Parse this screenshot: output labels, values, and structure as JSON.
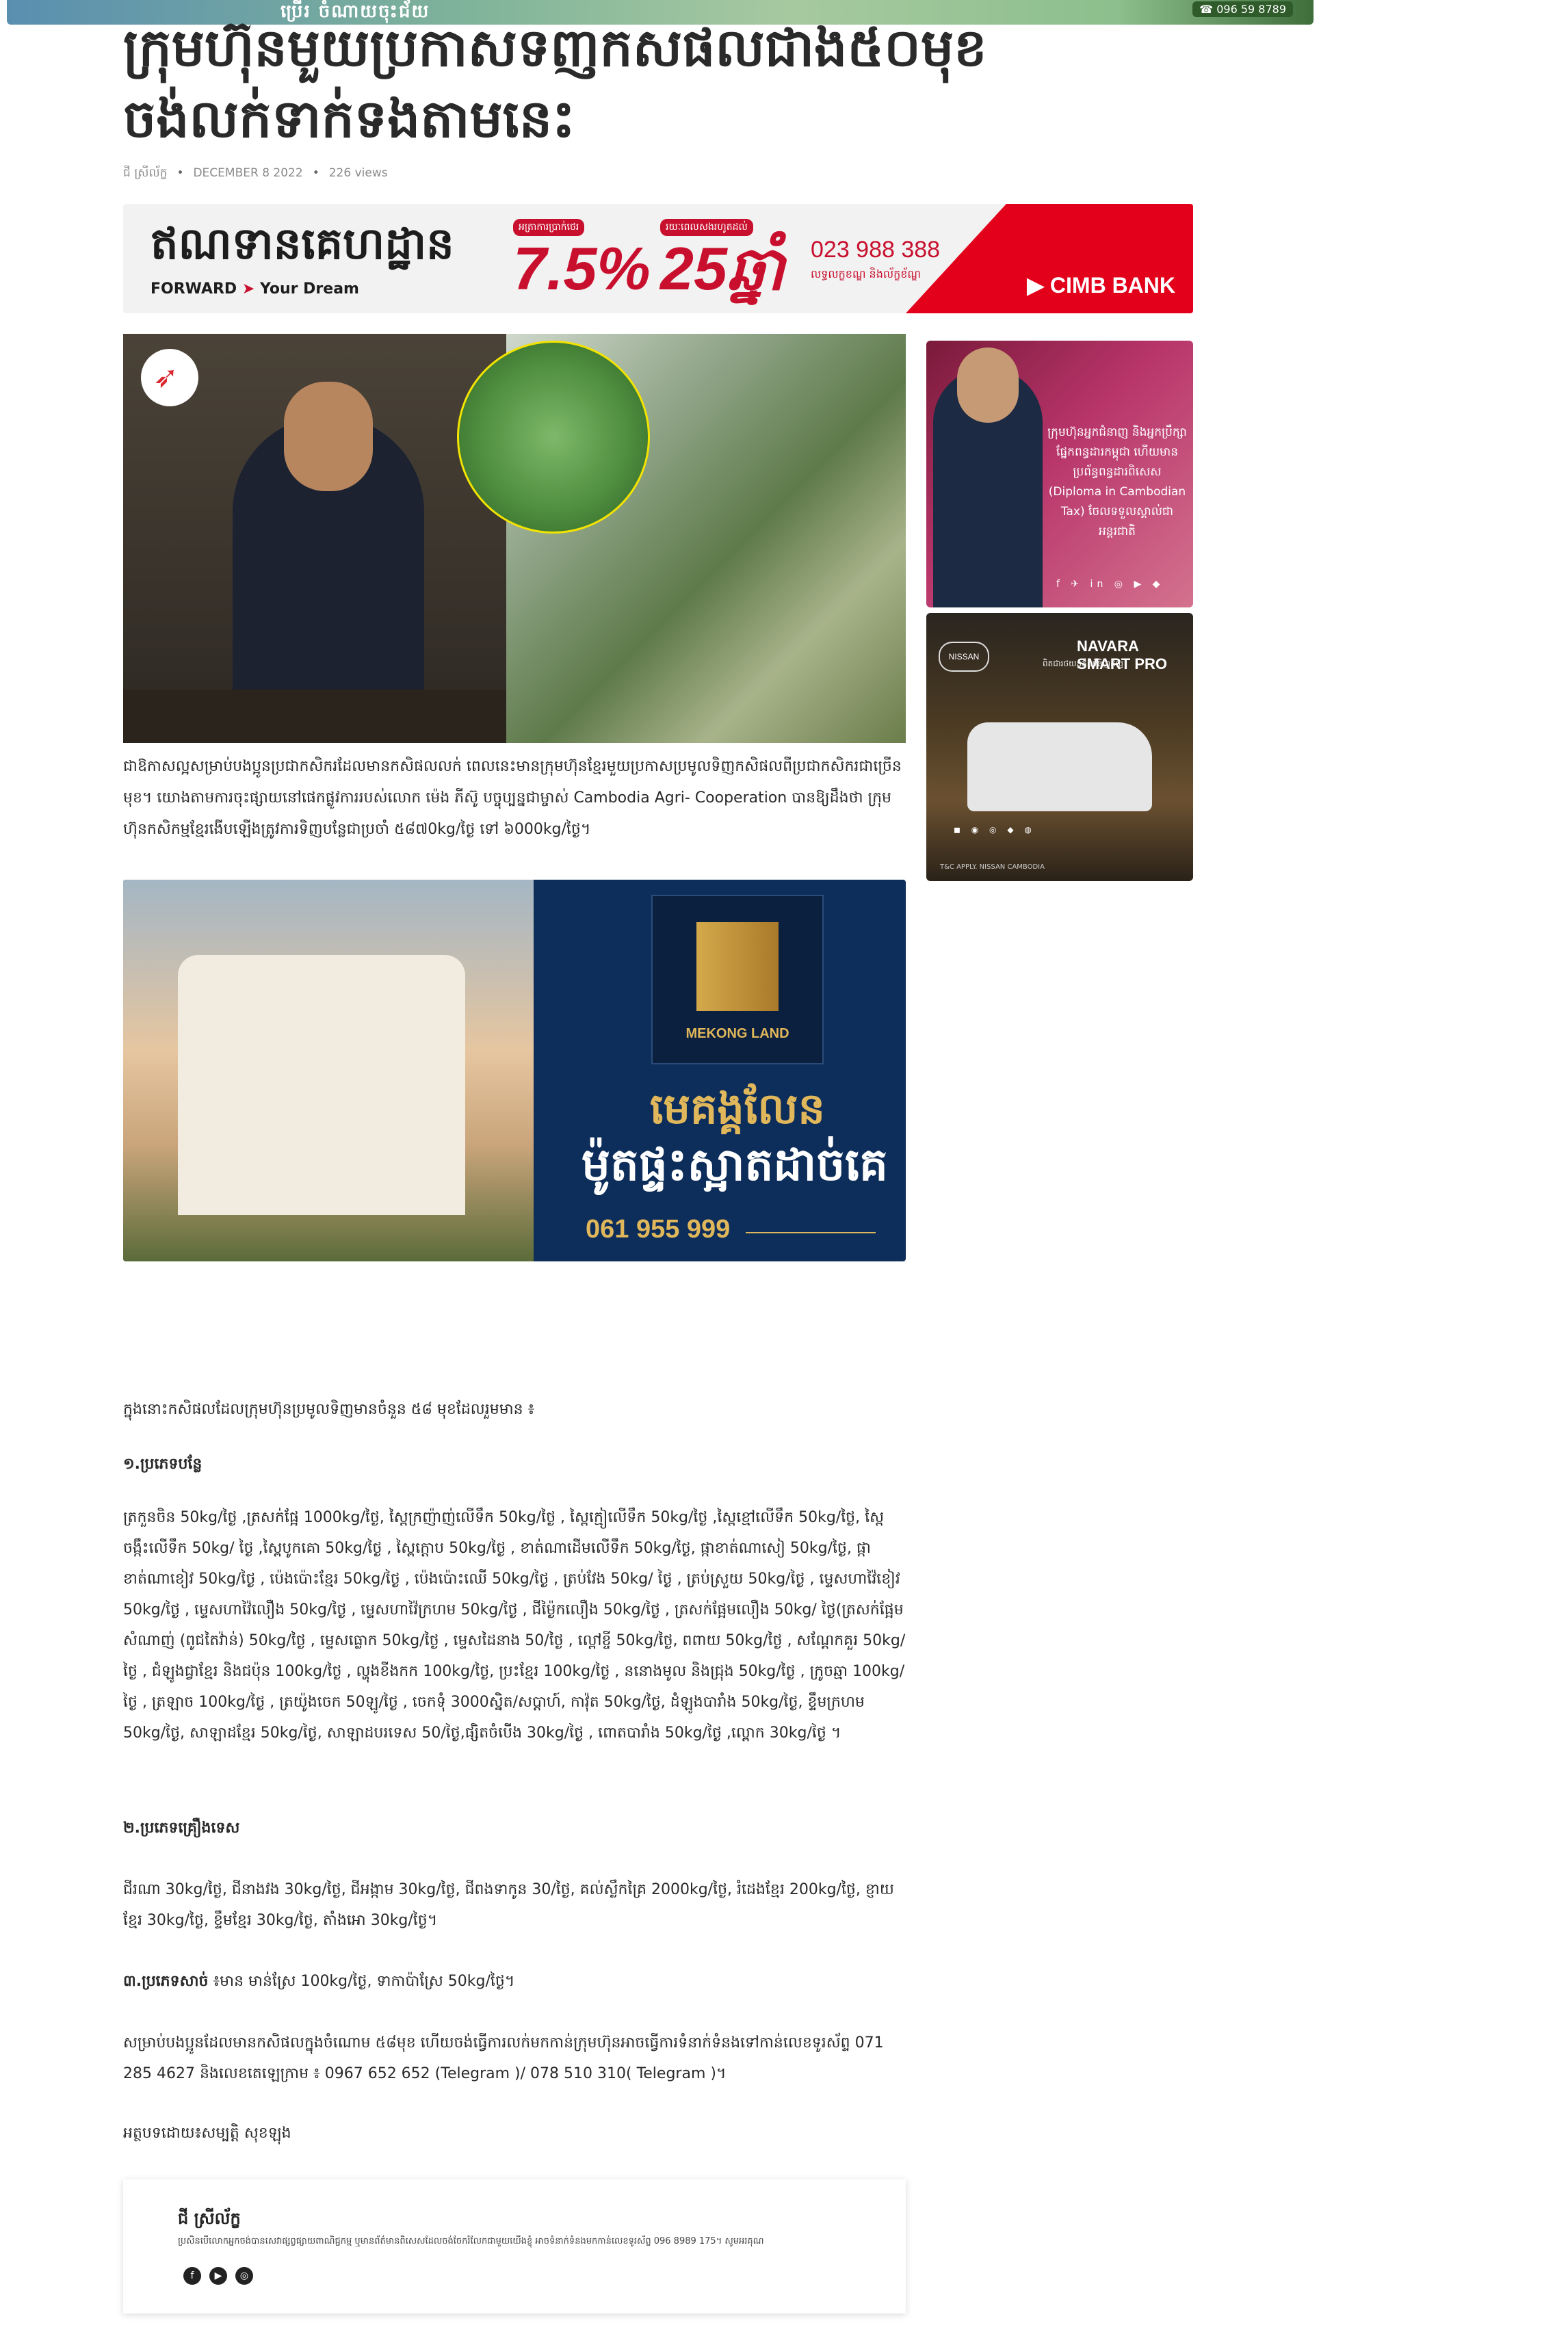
{
  "top_ad": {
    "text": "ប្រើរ ចំណាយចុះជ័យ",
    "phone": "☎ 096 59 8789"
  },
  "article": {
    "title": "ក្រុមហ៊ុនមួយប្រកាសទញកសផលជាង៥០មុខ ចង់លក់ទាក់ទងតាមនេះ",
    "author": "ជី ស្រីល័ក្ខ",
    "date": "DECEMBER 8 2022",
    "views": "226 views"
  },
  "cimb_banner": {
    "slogan": "ឥណទានគេហដ្ឋាន",
    "forward": "FORWARD",
    "your_dream": "Your Dream",
    "tag1": "អត្រាការប្រាក់ថេរ",
    "rate": "7.5%",
    "tag2": "រយៈពេលសងរហូតដល់",
    "years": "25ឆ្នាំ",
    "phone": "023 988 388",
    "phone_sub": "លទ្ធលក្ខខណ្ឌ និងល័ក្ខខ័ណ្ឌ",
    "brand": "CIMB BANK"
  },
  "hero_caption": "ជាឱកាសល្អសម្រាប់បងប្អូនប្រជាកសិករដែលមានកសិផលលក់ ពេលនេះមានក្រុមហ៊ុនខ្មែរមួយប្រកាសប្រមូលទិញកសិផលពីប្រជាកសិករជាច្រើនមុខ។ យោងតាមការចុះផ្សាយនៅផេកផ្លូវការរបស់លោក ម៉េង ភីស៊ូ បច្ចុប្បន្នជាម្ចាស់ Cambodia Agri- Cooperation បានឱ្យដឹងថា ក្រុមហ៊ុនកសិកម្មខ្មែរងើបឡើងត្រូវការទិញបន្លែជាប្រចាំ ៥៨៧0kg/ថ្ងៃ ទៅ ៦000kg/ថ្ងៃ។",
  "mekong_ad": {
    "logo_name": "MEKONG LAND",
    "line1": "មេគង្គលែន",
    "line2": "ម៉ូតផ្ទះស្អាតដាច់គេ",
    "phone": "061 955 999"
  },
  "side_ads": {
    "tax": {
      "text": "ក្រុមហ៊ុនអ្នកជំនាញ និងអ្នកប្រឹក្សាផ្នែកពន្ធដារកម្ពុជា ហើយមានប្រព័ន្ធពន្ធដារពិសេស (Diploma in Cambodian Tax) ចែលទទួលស្គាល់ជាអន្តរជាតិ",
      "icons": "f ✈ in ◎ ▶ ◆"
    },
    "nissan": {
      "brand": "NISSAN",
      "model": "NAVARA SMART PRO",
      "sub": "ពិតជារថយន្តដឹកទំនិញដ៏ល្អ",
      "features": "◼ ◉ ◎ ◆ ◍",
      "foot": "T&C APPLY. NISSAN CAMBODIA"
    }
  },
  "body": {
    "intro": "ក្នុងនោះកសិផលដែលក្រុមហ៊ុនប្រមូលទិញមានចំនួន ៥៨ មុខដែលរួមមាន ៖",
    "h1": "១.ប្រភេទបន្លែ",
    "p1": "ត្រកួនចិន 50kg/ថ្ងៃ ,ត្រសក់ផ្អែ 1000kg/ថ្ងៃ, ស្ពៃក្រញ៉ាញ់លើទឹក 50kg/ថ្ងៃ , ស្ពៃក្មៀលើទឹក 50kg/ថ្ងៃ ,ស្ពៃខ្មៅលើទឹក 50kg/ថ្ងៃ, ស្ពៃចង្កឹះលើទឹក 50kg/ ថ្ងៃ ,ស្ពៃបូកគោ 50kg/ថ្ងៃ , ស្ពៃក្ដោប 50kg/ថ្ងៃ , ខាត់ណាដើមលើទឹក 50kg/ថ្ងៃ, ផ្កាខាត់ណាសៀ 50kg/ថ្ងៃ, ផ្កាខាត់ណាខៀវ 50kg/ថ្ងៃ , ប៉េងប៉ោះខ្មែរ 50kg/ថ្ងៃ , ប៉េងប៉ោះឈើ 50kg/ថ្ងៃ , ត្រប់វែង 50kg/ ថ្ងៃ , ត្រប់ស្រួយ 50kg/ថ្ងៃ , ម្ទេសហាវ៉ៃខៀវ 50kg/ថ្ងៃ , ម្ទេសហាវ៉ៃលឿង 50kg/ថ្ងៃ , ម្ទេសហាវ៉ៃក្រហម 50kg/ថ្ងៃ , ជីម៉្ងៃកលឿង 50kg/ថ្ងៃ , ត្រសក់ផ្អែមលឿង 50kg/ ថ្ងៃ(ត្រសក់ផ្អែមសំណាញ់ (ពូជតៃវ៉ាន់) 50kg/ថ្ងៃ , ម្ទេសធ្លោក 50kg/ថ្ងៃ , ម្ទេសដៃនាង 50/ថ្ងៃ , ល្ពៅខ្ចី 50kg/ថ្ងៃ, ពពាយ 50kg/ថ្ងៃ , សណ្ដែកគួរ 50kg/ថ្ងៃ , ជំឡូងជ្វាខ្មែរ និងជប៉ុន 100kg/ថ្ងៃ , ល្ហុងខីងកក 100kg/ថ្ងៃ, ប្រះខ្មែរ 100kg/ថ្ងៃ , ននោងមូល និងជ្រុង 50kg/ថ្ងៃ , ក្រូចឆ្មា 100kg/ថ្ងៃ , ត្រឡាច 100kg/ថ្ងៃ , ត្រយ៉ូងចេក 50ឡូ/ថ្ងៃ , ចេកទុំ 3000ស្និត/សប្ដាហ៍, កាវ៉ុត 50kg/ថ្ងៃ, ដំឡូងបារាំង 50kg/ថ្ងៃ, ខ្ទឹមក្រហម 50kg/ថ្ងៃ, សាឡាដខ្មែរ 50kg/ថ្ងៃ, សាឡាដបរទេស 50/ថ្ងៃ,ផ្សិតចំបើង 30kg/ថ្ងៃ , ពោតបារាំង 50kg/ថ្ងៃ ,ល្ពោក 30kg/ថ្ងៃ ។",
    "h2": "២.ប្រភេទគ្រឿងទេស",
    "p2": "ជីរណា 30kg/ថ្ងៃ, ជីនាងវង 30kg/ថ្ងៃ, ជីអង្កាម 30kg/ថ្ងៃ, ជីពងទាកូន 30/ថ្ងៃ, គល់ស្លឹកគ្រៃ 2000kg/ថ្ងៃ, រំដេងខ្មែរ 200kg/ថ្ងៃ, ខ្ញាយខ្មែរ 30kg/ថ្ងៃ, ខ្ទឹមខ្មែរ 30kg/ថ្ងៃ, តាំងអោ 30kg/ថ្ងៃ។",
    "h3": "៣.ប្រភេទសាច់",
    "p3": "៖មាន មាន់ស្រែ 100kg/ថ្ងៃ, ទាកាប៉ាស្រែ 50kg/ថ្ងៃ។",
    "contact": "សម្រាប់បងប្អូនដែលមានកសិផលក្នុងចំណោម ៥៨មុខ ហើយចង់ធ្វើការលក់មកកាន់ក្រុមហ៊ុនអាចធ្វើការទំនាក់ទំនងទៅកាន់លេខទូរស័ព្ទ 071 285 4627 និងលេខតេឡេក្រាម ៖ 0967 652 652 (Telegram )/ 078 510 310( Telegram )។",
    "byline": "អត្ថបទដោយ៖សម្បត្តិ សុខឡុង"
  },
  "author_box": {
    "name": "ជី ស្រីល័ក្ខ",
    "bio": "ប្រសិនបើលោកអ្នកចង់បានសេវាផ្សព្វផ្សាយពាណិជ្ជកម្ម ឬមានព័ត៌មានពិសេសដែលចង់ចែករំលែកជាមួយយើងខ្ញុំ អាចទំនាក់ទំនងមកកាន់លេខទូរស័ព្ទ 096 8989 175។ សូមអរគុណ",
    "social": [
      "f",
      "▶",
      "◎"
    ]
  }
}
